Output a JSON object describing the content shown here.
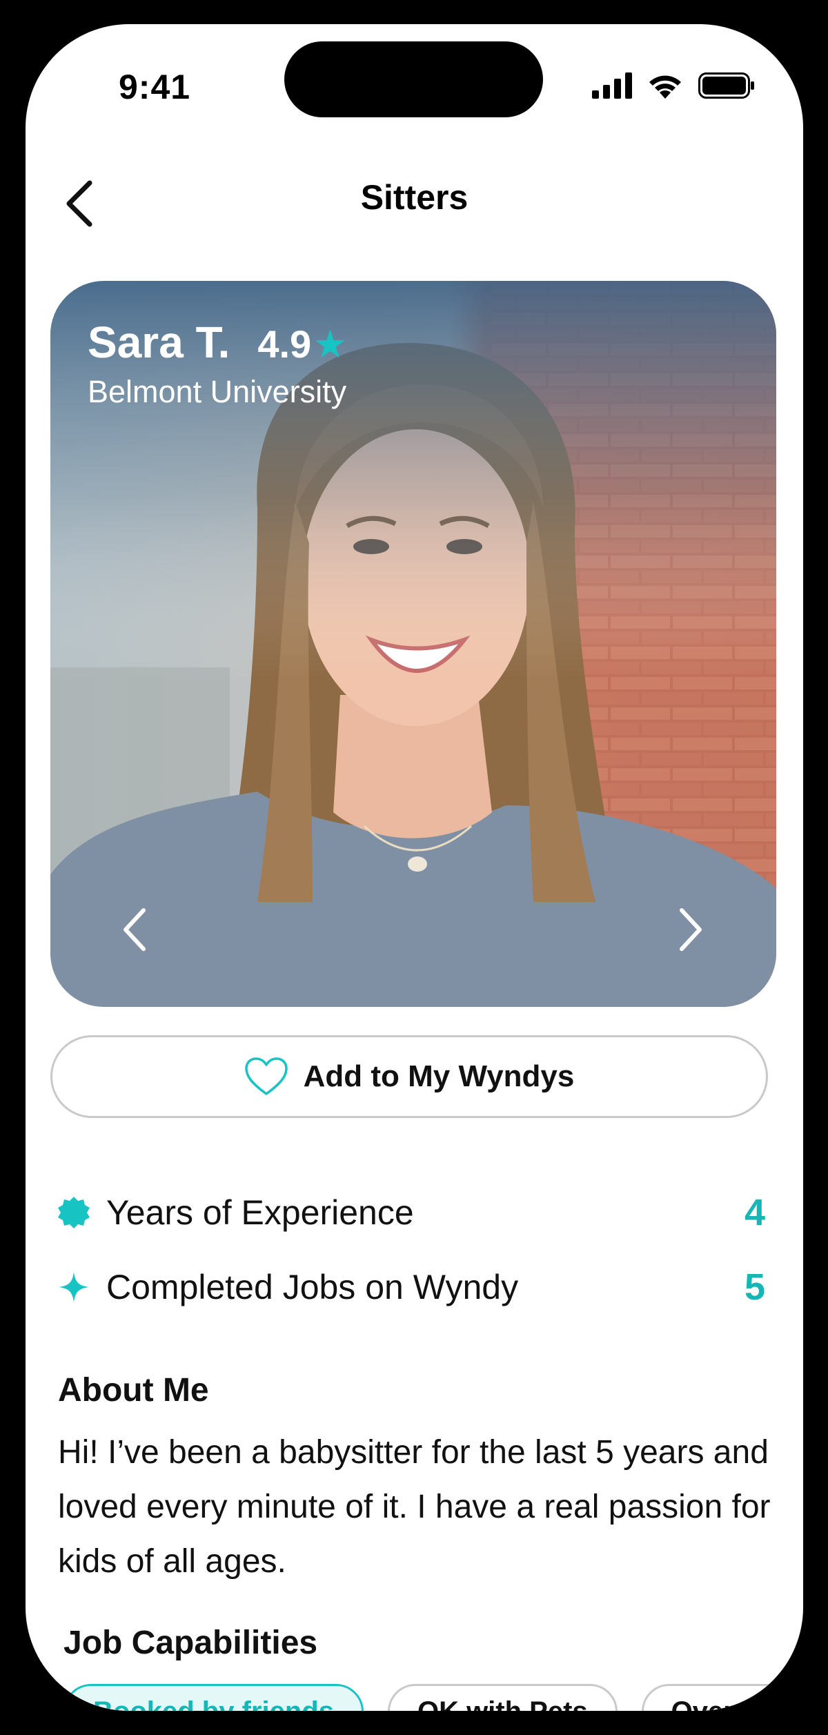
{
  "status_bar": {
    "time": "9:41"
  },
  "nav": {
    "title": "Sitters"
  },
  "profile": {
    "name": "Sara T.",
    "rating": "4.9",
    "star": "★",
    "school": "Belmont University"
  },
  "actions": {
    "add_label": "Add to My Wyndys"
  },
  "stats": [
    {
      "label": "Years of Experience",
      "value": "4",
      "icon": "badge-icon"
    },
    {
      "label": "Completed Jobs on Wyndy",
      "value": "5",
      "icon": "sparkle-icon"
    }
  ],
  "about": {
    "title": "About Me",
    "text": "Hi! I’ve been a babysitter for the last 5 years and loved every minute of it. I have a real passion for kids of all ages."
  },
  "capabilities": {
    "title": "Job Capabilities",
    "chips": [
      "Booked by friends",
      "OK with Pets",
      "Overnight"
    ]
  },
  "colors": {
    "accent": "#17c3c3",
    "accent_text": "#17b5b5",
    "border": "#c9c9c9"
  }
}
